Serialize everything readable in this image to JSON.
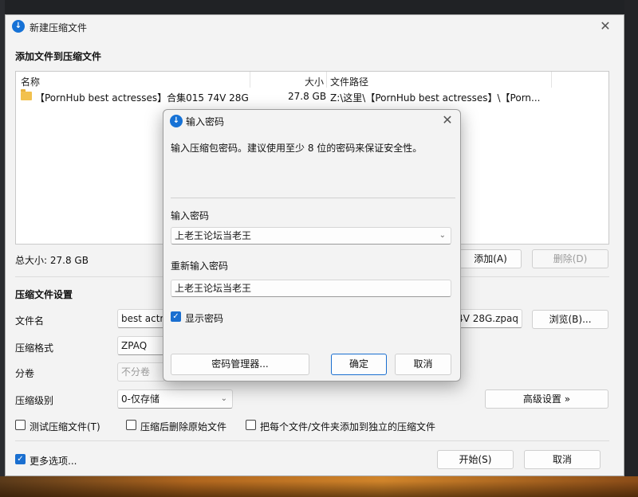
{
  "main_window": {
    "title": "新建压缩文件",
    "close_glyph": "✕",
    "section_files": "添加文件到压缩文件",
    "columns": {
      "name": "名称",
      "size": "大小",
      "path": "文件路径"
    },
    "files": [
      {
        "name": "【PornHub best actresses】合集015 74V 28G",
        "size": "27.8 GB",
        "path": "Z:\\这里\\【PornHub best actresses】\\【Porn..."
      }
    ],
    "total_size": "总大小: 27.8 GB",
    "add_button": "添加(A)",
    "delete_button": "删除(D)",
    "section_settings": "压缩文件设置",
    "filename_label": "文件名",
    "filename_value": "best actr",
    "filename_value_tail": "4V 28G.zpaq",
    "browse_button": "浏览(B)...",
    "format_label": "压缩格式",
    "format_value": "ZPAQ",
    "volume_label": "分卷",
    "volume_value": "不分卷",
    "level_label": "压缩级别",
    "level_value": "0-仅存储",
    "advanced_button": "高级设置 »",
    "test_checkbox": "测试压缩文件(T)",
    "delete_after_checkbox": "压缩后删除原始文件",
    "separate_checkbox": "把每个文件/文件夹添加到独立的压缩文件",
    "more_options_checkbox": "更多选项...",
    "start_button": "开始(S)",
    "cancel_button": "取消"
  },
  "password_dialog": {
    "title": "输入密码",
    "close_glyph": "✕",
    "message": "输入压缩包密码。建议使用至少 8 位的密码来保证安全性。",
    "password_label": "输入密码",
    "password_value": "上老王论坛当老王",
    "reenter_label": "重新输入密码",
    "reenter_value": "上老王论坛当老王",
    "show_password_label": "显示密码",
    "show_password_checked": true,
    "manager_button": "密码管理器...",
    "ok_button": "确定",
    "cancel_button": "取消"
  }
}
